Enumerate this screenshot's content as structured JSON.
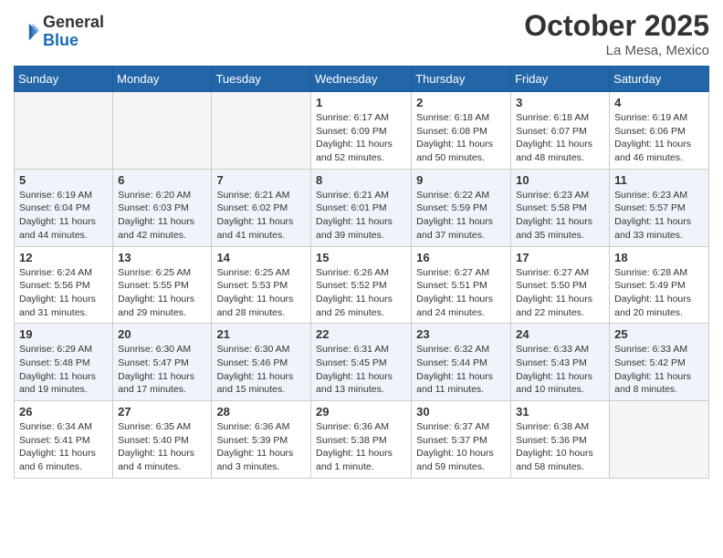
{
  "header": {
    "logo_general": "General",
    "logo_blue": "Blue",
    "month_title": "October 2025",
    "location": "La Mesa, Mexico"
  },
  "days_of_week": [
    "Sunday",
    "Monday",
    "Tuesday",
    "Wednesday",
    "Thursday",
    "Friday",
    "Saturday"
  ],
  "weeks": [
    [
      {
        "day": "",
        "info": ""
      },
      {
        "day": "",
        "info": ""
      },
      {
        "day": "",
        "info": ""
      },
      {
        "day": "1",
        "info": "Sunrise: 6:17 AM\nSunset: 6:09 PM\nDaylight: 11 hours\nand 52 minutes."
      },
      {
        "day": "2",
        "info": "Sunrise: 6:18 AM\nSunset: 6:08 PM\nDaylight: 11 hours\nand 50 minutes."
      },
      {
        "day": "3",
        "info": "Sunrise: 6:18 AM\nSunset: 6:07 PM\nDaylight: 11 hours\nand 48 minutes."
      },
      {
        "day": "4",
        "info": "Sunrise: 6:19 AM\nSunset: 6:06 PM\nDaylight: 11 hours\nand 46 minutes."
      }
    ],
    [
      {
        "day": "5",
        "info": "Sunrise: 6:19 AM\nSunset: 6:04 PM\nDaylight: 11 hours\nand 44 minutes."
      },
      {
        "day": "6",
        "info": "Sunrise: 6:20 AM\nSunset: 6:03 PM\nDaylight: 11 hours\nand 42 minutes."
      },
      {
        "day": "7",
        "info": "Sunrise: 6:21 AM\nSunset: 6:02 PM\nDaylight: 11 hours\nand 41 minutes."
      },
      {
        "day": "8",
        "info": "Sunrise: 6:21 AM\nSunset: 6:01 PM\nDaylight: 11 hours\nand 39 minutes."
      },
      {
        "day": "9",
        "info": "Sunrise: 6:22 AM\nSunset: 5:59 PM\nDaylight: 11 hours\nand 37 minutes."
      },
      {
        "day": "10",
        "info": "Sunrise: 6:23 AM\nSunset: 5:58 PM\nDaylight: 11 hours\nand 35 minutes."
      },
      {
        "day": "11",
        "info": "Sunrise: 6:23 AM\nSunset: 5:57 PM\nDaylight: 11 hours\nand 33 minutes."
      }
    ],
    [
      {
        "day": "12",
        "info": "Sunrise: 6:24 AM\nSunset: 5:56 PM\nDaylight: 11 hours\nand 31 minutes."
      },
      {
        "day": "13",
        "info": "Sunrise: 6:25 AM\nSunset: 5:55 PM\nDaylight: 11 hours\nand 29 minutes."
      },
      {
        "day": "14",
        "info": "Sunrise: 6:25 AM\nSunset: 5:53 PM\nDaylight: 11 hours\nand 28 minutes."
      },
      {
        "day": "15",
        "info": "Sunrise: 6:26 AM\nSunset: 5:52 PM\nDaylight: 11 hours\nand 26 minutes."
      },
      {
        "day": "16",
        "info": "Sunrise: 6:27 AM\nSunset: 5:51 PM\nDaylight: 11 hours\nand 24 minutes."
      },
      {
        "day": "17",
        "info": "Sunrise: 6:27 AM\nSunset: 5:50 PM\nDaylight: 11 hours\nand 22 minutes."
      },
      {
        "day": "18",
        "info": "Sunrise: 6:28 AM\nSunset: 5:49 PM\nDaylight: 11 hours\nand 20 minutes."
      }
    ],
    [
      {
        "day": "19",
        "info": "Sunrise: 6:29 AM\nSunset: 5:48 PM\nDaylight: 11 hours\nand 19 minutes."
      },
      {
        "day": "20",
        "info": "Sunrise: 6:30 AM\nSunset: 5:47 PM\nDaylight: 11 hours\nand 17 minutes."
      },
      {
        "day": "21",
        "info": "Sunrise: 6:30 AM\nSunset: 5:46 PM\nDaylight: 11 hours\nand 15 minutes."
      },
      {
        "day": "22",
        "info": "Sunrise: 6:31 AM\nSunset: 5:45 PM\nDaylight: 11 hours\nand 13 minutes."
      },
      {
        "day": "23",
        "info": "Sunrise: 6:32 AM\nSunset: 5:44 PM\nDaylight: 11 hours\nand 11 minutes."
      },
      {
        "day": "24",
        "info": "Sunrise: 6:33 AM\nSunset: 5:43 PM\nDaylight: 11 hours\nand 10 minutes."
      },
      {
        "day": "25",
        "info": "Sunrise: 6:33 AM\nSunset: 5:42 PM\nDaylight: 11 hours\nand 8 minutes."
      }
    ],
    [
      {
        "day": "26",
        "info": "Sunrise: 6:34 AM\nSunset: 5:41 PM\nDaylight: 11 hours\nand 6 minutes."
      },
      {
        "day": "27",
        "info": "Sunrise: 6:35 AM\nSunset: 5:40 PM\nDaylight: 11 hours\nand 4 minutes."
      },
      {
        "day": "28",
        "info": "Sunrise: 6:36 AM\nSunset: 5:39 PM\nDaylight: 11 hours\nand 3 minutes."
      },
      {
        "day": "29",
        "info": "Sunrise: 6:36 AM\nSunset: 5:38 PM\nDaylight: 11 hours\nand 1 minute."
      },
      {
        "day": "30",
        "info": "Sunrise: 6:37 AM\nSunset: 5:37 PM\nDaylight: 10 hours\nand 59 minutes."
      },
      {
        "day": "31",
        "info": "Sunrise: 6:38 AM\nSunset: 5:36 PM\nDaylight: 10 hours\nand 58 minutes."
      },
      {
        "day": "",
        "info": ""
      }
    ]
  ]
}
